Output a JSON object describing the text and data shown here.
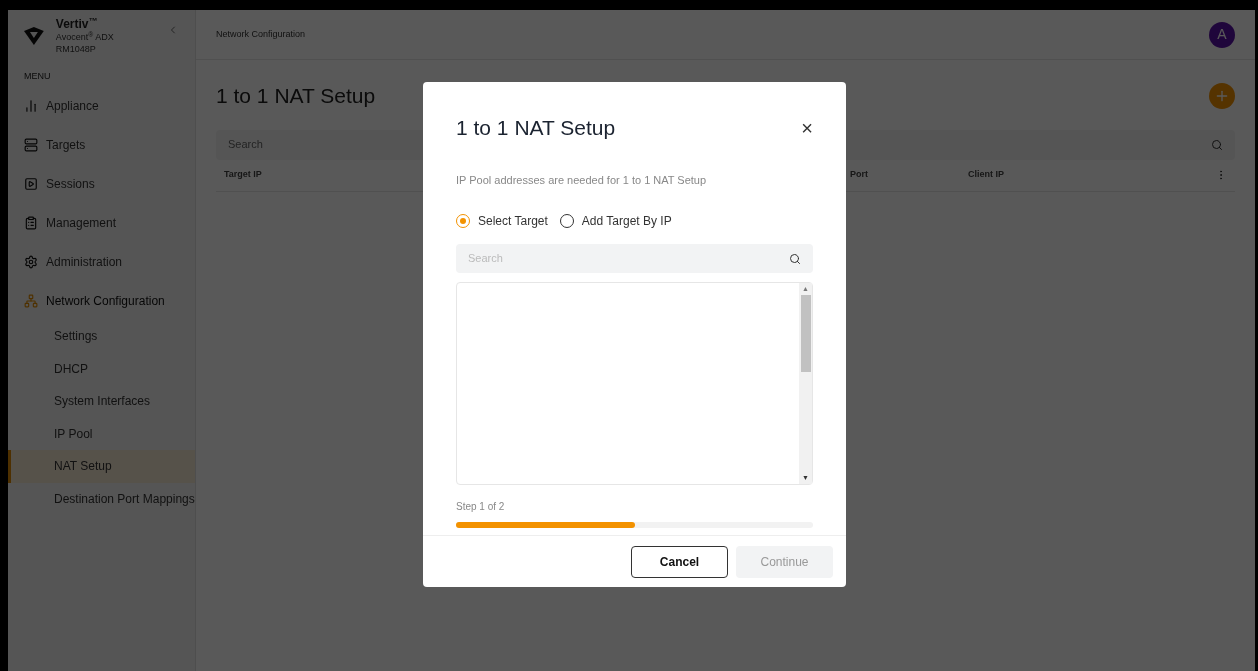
{
  "brand": {
    "name": "Vertiv$^{™}$",
    "product": "Avocent$^{®}$ ADX RM1048P"
  },
  "sidebar": {
    "heading": "MENU",
    "items": [
      {
        "label": "Appliance",
        "selected": false
      },
      {
        "label": "Targets",
        "selected": false
      },
      {
        "label": "Sessions",
        "selected": false
      },
      {
        "label": "Management",
        "selected": false
      },
      {
        "label": "Administration",
        "selected": false
      },
      {
        "label": "Network Configuration",
        "selected": true,
        "expanded": true,
        "children": [
          {
            "label": "Settings",
            "selected": false
          },
          {
            "label": "DHCP",
            "selected": false
          },
          {
            "label": "System Interfaces",
            "selected": false
          },
          {
            "label": "IP Pool",
            "selected": false
          },
          {
            "label": "NAT Setup",
            "selected": true
          },
          {
            "label": "Destination Port Mappings",
            "selected": false
          }
        ]
      }
    ]
  },
  "header": {
    "breadcrumb": "Network Configuration",
    "avatar": "A"
  },
  "page": {
    "title": "1 to 1 NAT Setup",
    "search": {
      "placeholder": "Search"
    },
    "table": {
      "columns": [
        "Target IP",
        "Port",
        "Client IP"
      ]
    }
  },
  "dialog": {
    "title": "1 to 1 NAT Setup",
    "close": "×",
    "description": "IP Pool addresses are needed for 1 to 1 NAT Setup",
    "options": [
      {
        "label": "Select Target",
        "selected": true
      },
      {
        "label": "Add Target By IP",
        "selected": false
      }
    ],
    "search": {
      "placeholder": "Search"
    },
    "scroll_up": "▲",
    "scroll_down": "▼",
    "step": "Step 1 of 2",
    "progress": {
      "level": 0.5
    },
    "buttons": [
      {
        "label": "Cancel",
        "kind": "secondary",
        "disabled": false
      },
      {
        "label": "Continue",
        "kind": "primary",
        "disabled": true
      }
    ]
  }
}
